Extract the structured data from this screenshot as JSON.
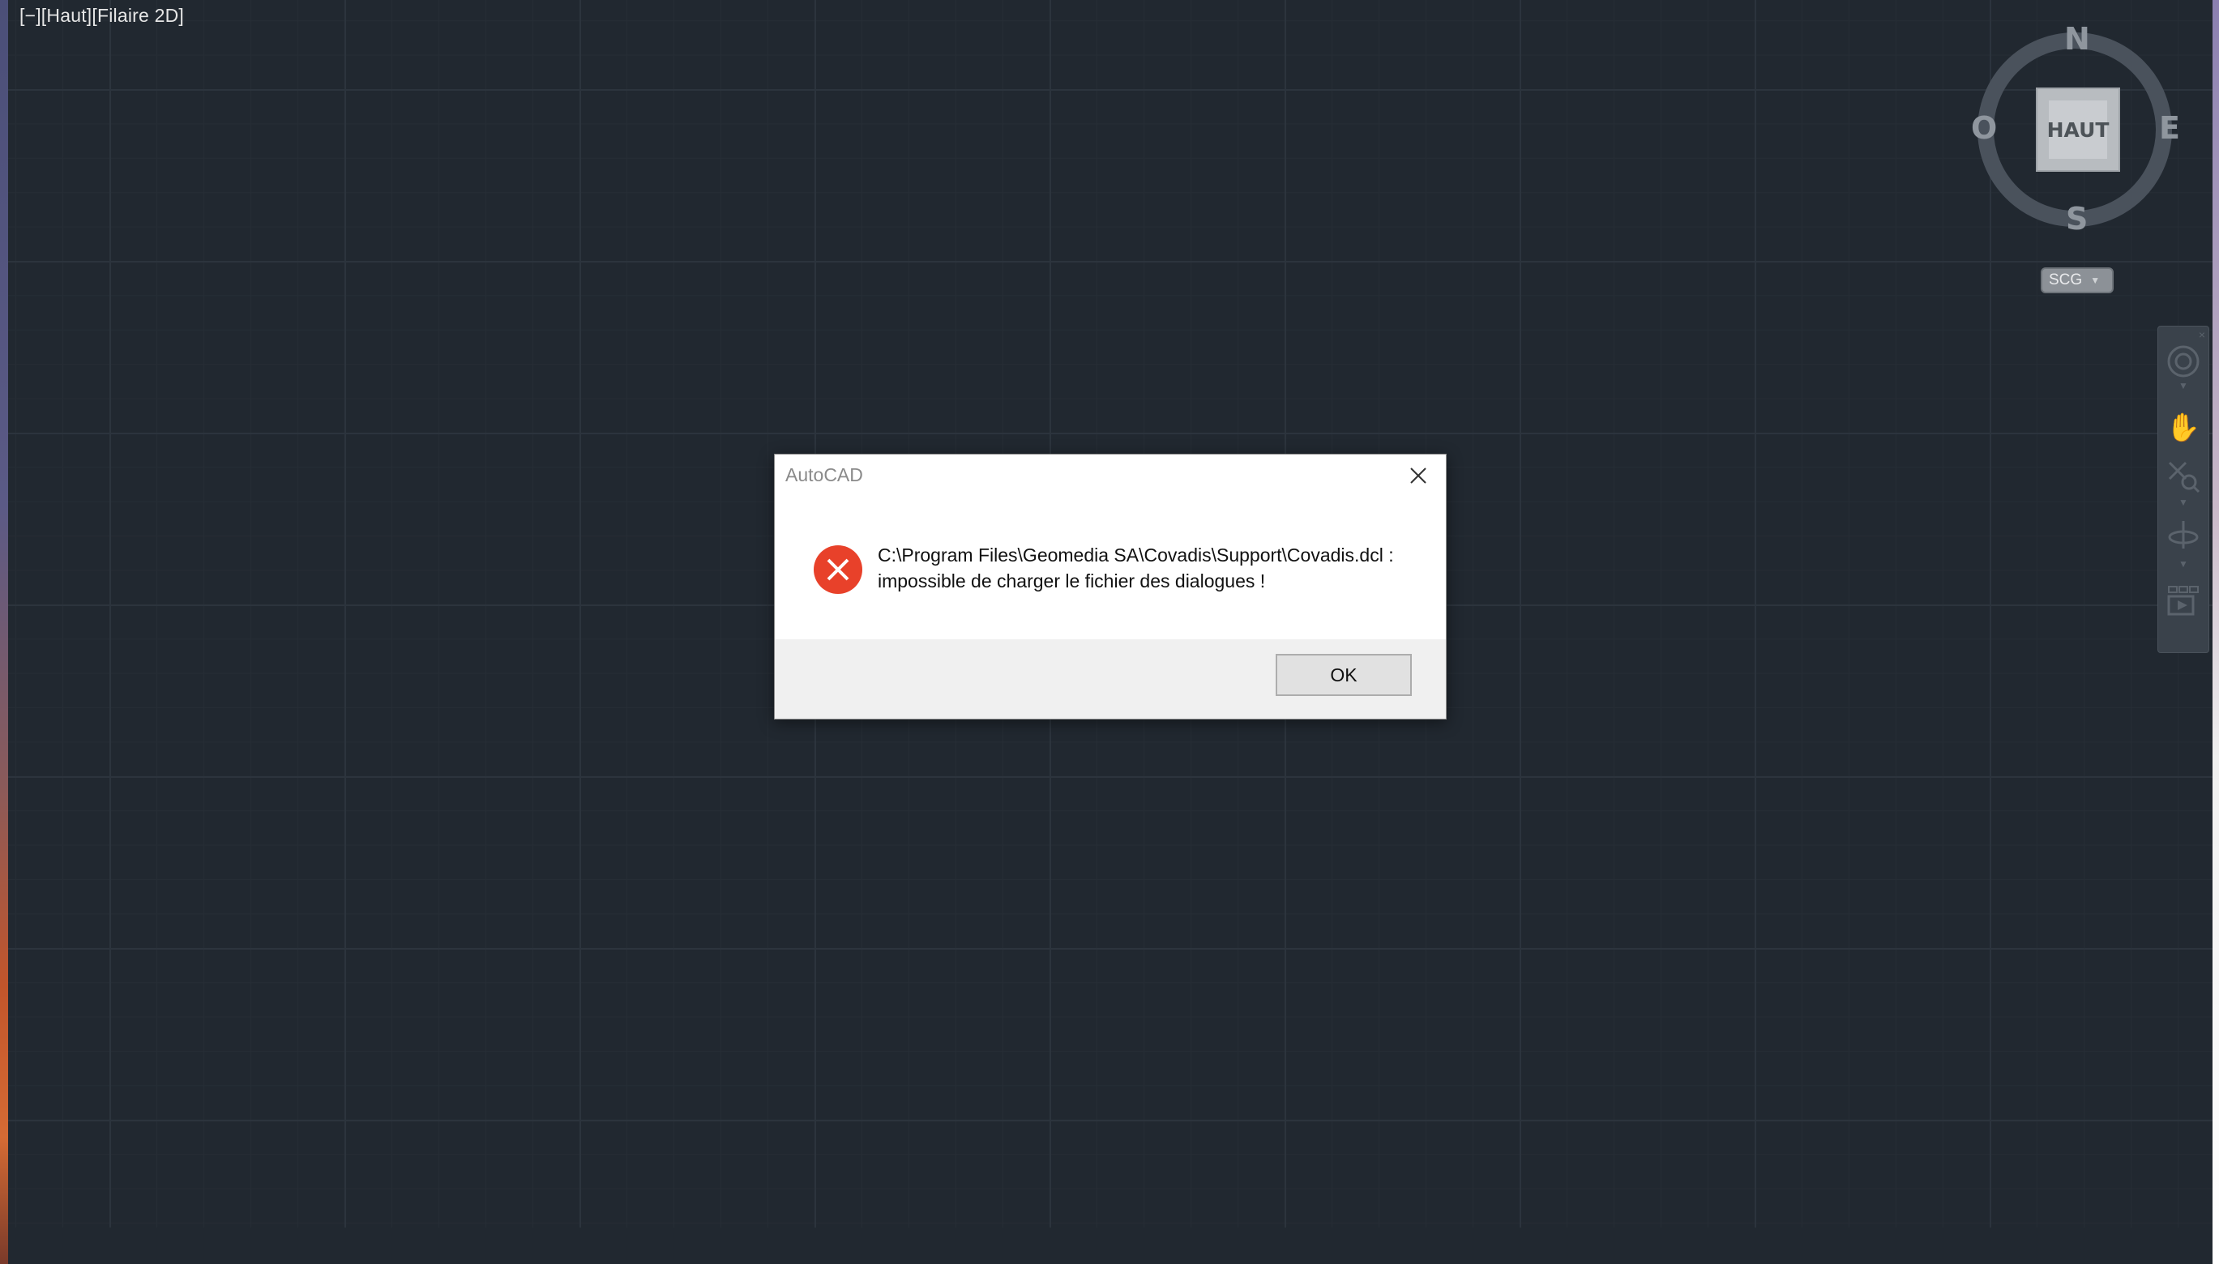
{
  "viewport": {
    "label": "[−][Haut][Filaire 2D]"
  },
  "viewcube": {
    "north": "N",
    "south": "S",
    "east": "E",
    "west": "O",
    "face": "HAUT",
    "ucs_label": "SCG"
  },
  "navbar": {
    "icons": [
      "steering-wheel-icon",
      "pan-hand-icon",
      "zoom-extents-icon",
      "orbit-icon",
      "showmotion-icon"
    ]
  },
  "dialog": {
    "title": "AutoCAD",
    "message_line1": "C:\\Program Files\\Geomedia SA\\Covadis\\Support\\Covadis.dcl :",
    "message_line2": "impossible de charger le fichier des dialogues !",
    "ok_label": "OK",
    "icon": "error-icon"
  },
  "colors": {
    "background": "#212830",
    "error_red": "#e8412a",
    "dialog_footer": "#f0f0f0"
  }
}
